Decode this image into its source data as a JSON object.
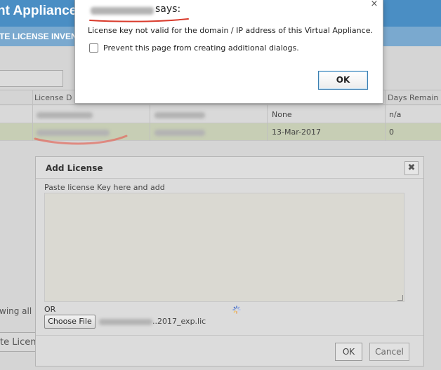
{
  "app": {
    "title": "nt Appliance",
    "subtitle": "TE LICENSE INVENTO"
  },
  "table": {
    "columns": [
      "License D",
      "Days Remain"
    ],
    "rows": [
      {
        "status": "None",
        "days": "n/a"
      },
      {
        "status": "13-Mar-2017",
        "days": "0"
      }
    ],
    "showing_text": "wing all",
    "bottom_button": "te Licen"
  },
  "add_license_dialog": {
    "title": "Add License",
    "close_glyph": "✖",
    "paste_label": "Paste license Key here and add",
    "or_text": "OR",
    "choose_file_label": "Choose File",
    "file_name_visible": "..2017_exp.lic",
    "ok_label": "OK",
    "cancel_label": "Cancel"
  },
  "alert": {
    "says": "says:",
    "message": "License key not valid for the domain / IP address of this Virtual Appliance.",
    "checkbox_label": "Prevent this page from creating additional dialogs.",
    "checkbox_checked": false,
    "ok_label": "OK",
    "close_glyph": "×"
  },
  "colors": {
    "header_blue": "#4a8ec4",
    "subbar_blue": "#7aa9cf",
    "highlight_row": "#c7ceb5",
    "redaction_underline": "#d93a2b",
    "alert_ok_border": "#3c7fb1"
  },
  "icons": {
    "loading": "loading-spinner-icon",
    "dialog_close": "close-icon",
    "alert_close": "close-icon"
  }
}
